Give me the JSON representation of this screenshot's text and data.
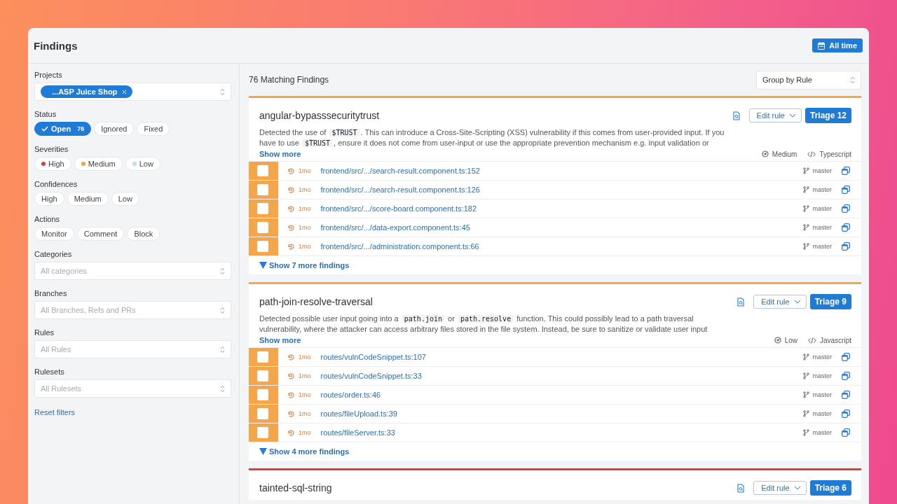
{
  "window": {
    "title": "Findings",
    "date_button": "All time"
  },
  "filters": {
    "sections": [
      {
        "kind": "multiselect",
        "label": "Projects",
        "tags": [
          {
            "label": "...ASP Juice Shop"
          }
        ]
      },
      {
        "kind": "chips",
        "label": "Status",
        "chips": [
          {
            "label": "Open",
            "count": "76",
            "selected": true
          },
          {
            "label": "Ignored",
            "selected": false
          },
          {
            "label": "Fixed",
            "selected": false
          }
        ]
      },
      {
        "kind": "chips",
        "label": "Severities",
        "chips": [
          {
            "label": "High",
            "color": "#dc3a3a",
            "selected": false
          },
          {
            "label": "Medium",
            "color": "#f0a04b",
            "selected": false
          },
          {
            "label": "Low",
            "color": "#b9e0dc",
            "selected": false
          }
        ]
      },
      {
        "kind": "chips",
        "label": "Confidences",
        "chips": [
          {
            "label": "High",
            "selected": false
          },
          {
            "label": "Medium",
            "selected": false
          },
          {
            "label": "Low",
            "selected": false
          }
        ]
      },
      {
        "kind": "chips",
        "label": "Actions",
        "chips": [
          {
            "label": "Monitor",
            "selected": false
          },
          {
            "label": "Comment",
            "selected": false
          },
          {
            "label": "Block",
            "selected": false
          }
        ]
      },
      {
        "kind": "select",
        "label": "Categories",
        "placeholder": "All categories"
      },
      {
        "kind": "select",
        "label": "Branches",
        "placeholder": "All Branches, Refs and PRs"
      },
      {
        "kind": "select",
        "label": "Rules",
        "placeholder": "All Rules"
      },
      {
        "kind": "select",
        "label": "Rulesets",
        "placeholder": "All Rulesets"
      }
    ],
    "reset": "Reset filters"
  },
  "results": {
    "count_label": "76 Matching Findings",
    "group_by": "Group by Rule"
  },
  "rules": [
    {
      "name": "angular-bypasssecuritytrust",
      "color": "#f5a64a",
      "edit": "Edit rule",
      "triage": "Triage 12",
      "description": [
        {
          "text": "Detected the use of ",
          "code": false
        },
        {
          "text": "$TRUST",
          "code": true
        },
        {
          "text": ". This can introduce a Cross-Site-Scripting (XSS) vulnerability if this comes from user-provided input. If you have to use ",
          "code": false
        },
        {
          "text": "$TRUST",
          "code": true
        },
        {
          "text": ", ensure it does not come from user-input or use the appropriate prevention mechanism e.g. input validation or",
          "code": false
        }
      ],
      "show_more": "Show more",
      "confidence": "Medium",
      "language": "Typescript",
      "findings": [
        {
          "age": "1mo",
          "path": "frontend/src/.../search-result.component.ts:152",
          "branch": "master",
          "checked": false
        },
        {
          "age": "1mo",
          "path": "frontend/src/.../search-result.component.ts:126",
          "branch": "master",
          "checked": false
        },
        {
          "age": "1mo",
          "path": "frontend/src/.../score-board.component.ts:182",
          "branch": "master",
          "checked": false
        },
        {
          "age": "1mo",
          "path": "frontend/src/.../data-export.component.ts:45",
          "branch": "master",
          "checked": false
        },
        {
          "age": "1mo",
          "path": "frontend/src/.../administration.component.ts:66",
          "branch": "master",
          "checked": false
        }
      ],
      "more": "Show 7 more findings"
    },
    {
      "name": "path-join-resolve-traversal",
      "color": "#f5a64a",
      "edit": "Edit rule",
      "triage": "Triage 9",
      "description": [
        {
          "text": "Detected possible user input going into a ",
          "code": false
        },
        {
          "text": "path.join",
          "code": true
        },
        {
          "text": " or ",
          "code": false
        },
        {
          "text": "path.resolve",
          "code": true
        },
        {
          "text": " function. This could possibly lead to a path traversal vulnerability, where the attacker can access arbitrary files stored in the file system. Instead, be sure to sanitize or validate user input",
          "code": false
        }
      ],
      "show_more": "Show more",
      "confidence": "Low",
      "language": "Javascript",
      "findings": [
        {
          "age": "1mo",
          "path": "routes/vulnCodeSnippet.ts:107",
          "branch": "master",
          "checked": false
        },
        {
          "age": "1mo",
          "path": "routes/vulnCodeSnippet.ts:33",
          "branch": "master",
          "checked": false
        },
        {
          "age": "1mo",
          "path": "routes/order.ts:46",
          "branch": "master",
          "checked": false
        },
        {
          "age": "1mo",
          "path": "routes/fileUpload.ts:39",
          "branch": "master",
          "checked": false
        },
        {
          "age": "1mo",
          "path": "routes/fileServer.ts:33",
          "branch": "master",
          "checked": false
        }
      ],
      "more": "Show 4 more findings"
    },
    {
      "name": "tainted-sql-string",
      "color": "#e03c3c",
      "edit": "Edit rule",
      "triage": "Triage 6"
    }
  ]
}
